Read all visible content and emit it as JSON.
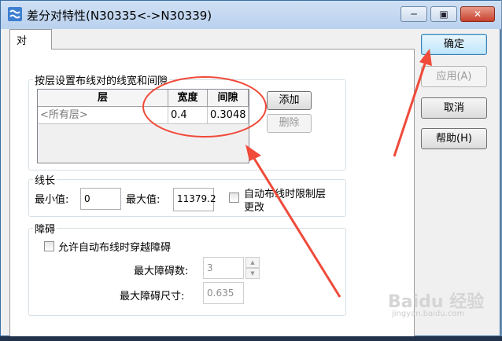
{
  "window": {
    "title": "差分对特性(N30335<->N30339)"
  },
  "tab": {
    "label": "对"
  },
  "layer_group": {
    "label": "按层设置布线对的线宽和间隙",
    "columns": [
      "层",
      "宽度",
      "间隙"
    ],
    "rows": [
      {
        "layer": "<所有层>",
        "width": "0.4",
        "gap": "0.3048"
      }
    ],
    "add_label": "添加",
    "delete_label": "删除"
  },
  "length_group": {
    "label": "线长",
    "min_label": "最小值:",
    "min_value": "0",
    "max_label": "最大值:",
    "max_value": "11379.2",
    "restrict_label_1": "自动布线时限制层",
    "restrict_label_2": "更改"
  },
  "obstacle_group": {
    "label": "障碍",
    "allow_label": "允许自动布线时穿越障碍",
    "max_count_label": "最大障碍数:",
    "max_count_value": "3",
    "max_size_label": "最大障碍尺寸:",
    "max_size_value": "0.635"
  },
  "side_buttons": {
    "ok": "确定",
    "apply": "应用(A)",
    "cancel": "取消",
    "help": "帮助(H)"
  },
  "watermark": {
    "text": "Baidu 经验",
    "subtext": "jingyan.baidu.com"
  },
  "colors": {
    "annotation": "#f04a3a",
    "titlebar": "#c2d7f0",
    "close": "#c7412d"
  }
}
